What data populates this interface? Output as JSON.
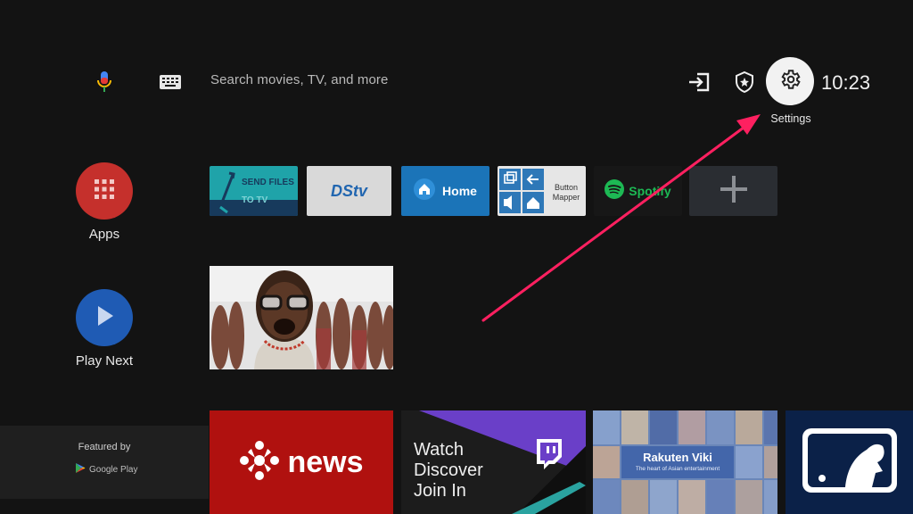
{
  "top_bar": {
    "search_placeholder": "Search movies, TV, and more",
    "settings_label": "Settings",
    "clock": "10:23"
  },
  "left_rail": {
    "apps_label": "Apps",
    "play_next_label": "Play Next",
    "featured_by_label": "Featured by",
    "google_play_label": "Google Play"
  },
  "app_tiles": {
    "send_files_line1": "SEND FILES",
    "send_files_line2": "TO TV",
    "dstv_label": "DStv",
    "home_label": "Home",
    "button_mapper_line1": "Button",
    "button_mapper_line2": "Mapper",
    "spotify_label": "Spotify"
  },
  "channel_cards": {
    "news_label": "news",
    "twitch_line1": "Watch",
    "twitch_line2": "Discover",
    "twitch_line3": "Join In",
    "viki_title": "Rakuten Viki",
    "viki_subtitle": "The heart of Asian entertainment"
  },
  "colors": {
    "apps_red": "#c5302c",
    "play_next_blue": "#1f5bb4",
    "annotation_arrow": "#ff2060"
  }
}
